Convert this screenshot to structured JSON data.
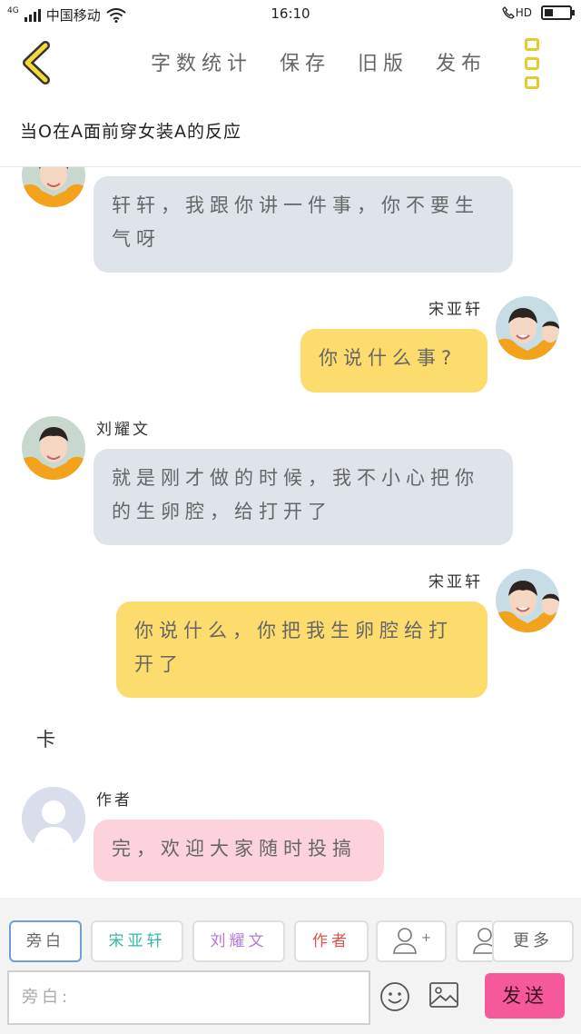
{
  "status_bar": {
    "network": "4G",
    "carrier": "中国移动",
    "time": "16:10",
    "hd_label": "HD",
    "battery_level": 0.35
  },
  "toolbar": {
    "back_icon": "chevron-left-icon",
    "tabs": [
      "字数统计",
      "保存",
      "旧版",
      "发布"
    ],
    "menu_icon": "vertical-dots-menu-icon",
    "accent": "#e3cc2e"
  },
  "story_title": "当O在A面前穿女装A的反应",
  "messages": [
    {
      "side": "left",
      "name": "",
      "text": "轩轩，我跟你讲一件事，你不要生气呀",
      "bubble_color": "#dfe4ea"
    },
    {
      "side": "right",
      "name": "宋亚轩",
      "text": "你说什么事?",
      "bubble_color": "#fcdc6c"
    },
    {
      "side": "left",
      "name": "刘耀文",
      "text": "就是刚才做的时候，我不小心把你的生卵腔，给打开了",
      "bubble_color": "#dfe4ea"
    },
    {
      "side": "right",
      "name": "宋亚轩",
      "text": "你说什么，你把我生卵腔给打开了",
      "bubble_color": "#fcdc6c"
    },
    {
      "type": "narration",
      "text": "卡"
    },
    {
      "side": "left",
      "name": "作者",
      "text": "完，欢迎大家随时投搞",
      "bubble_color": "#fcd2dc"
    }
  ],
  "role_bar": {
    "roles": [
      {
        "label": "旁白",
        "color": "#666666",
        "active": true
      },
      {
        "label": "宋亚轩",
        "color": "#35b8a8",
        "active": false
      },
      {
        "label": "刘耀文",
        "color": "#b57ad6",
        "active": false
      },
      {
        "label": "作者",
        "color": "#e0504a",
        "active": false
      }
    ],
    "add_role_icon": "add-person-icon",
    "add_symbol": "+",
    "more_label": "更多"
  },
  "composer": {
    "placeholder": "旁白:",
    "emoji_icon": "smiley-icon",
    "image_icon": "image-icon",
    "send_label": "发送",
    "send_color": "#f5599a"
  }
}
